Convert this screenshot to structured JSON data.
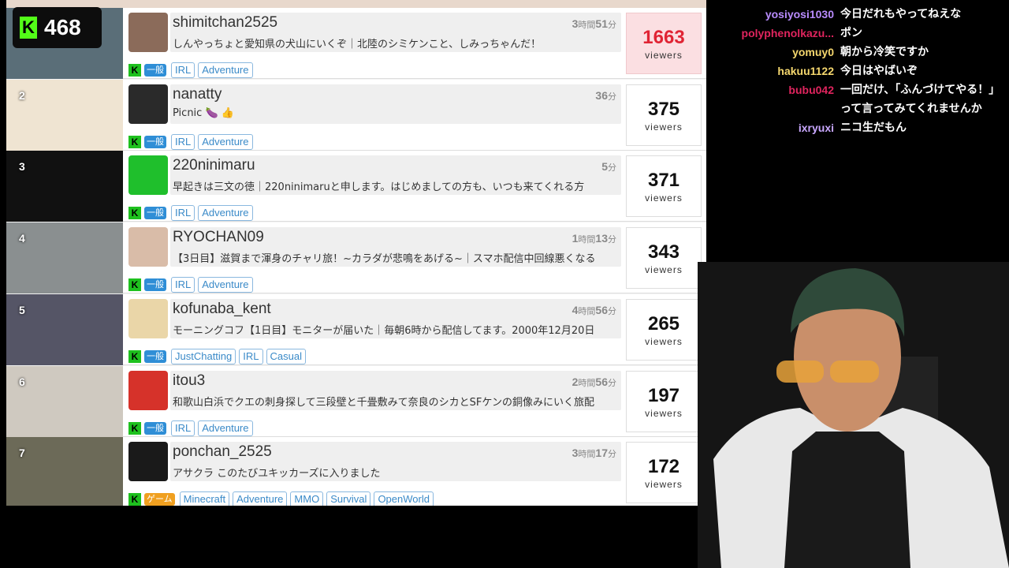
{
  "counter": {
    "value": "468",
    "k": "K"
  },
  "rows": [
    {
      "rank": "",
      "name": "shimitchan2525",
      "time_h": "3",
      "time_m": "51",
      "desc": "しんやっちょと愛知県の犬山にいくぞ｜北陸のシミケンこと、しみっちゃんだ！",
      "cat": "一般",
      "tags": [
        "IRL",
        "Adventure"
      ],
      "viewers": "1663"
    },
    {
      "rank": "2",
      "name": "nanatty",
      "time_h": "",
      "time_m": "36",
      "desc": "Picnic 🍆 👍",
      "cat": "一般",
      "tags": [
        "IRL",
        "Adventure"
      ],
      "viewers": "375"
    },
    {
      "rank": "3",
      "name": "220ninimaru",
      "time_h": "",
      "time_m": "5",
      "desc": "早起きは三文の徳｜220ninimaruと申します。はじめましての方も、いつも来てくれる方",
      "cat": "一般",
      "tags": [
        "IRL",
        "Adventure"
      ],
      "viewers": "371"
    },
    {
      "rank": "4",
      "name": "RYOCHAN09",
      "time_h": "1",
      "time_m": "13",
      "desc": "【3日目】滋賀まで渾身のチャリ旅！~カラダが悲鳴をあげる~｜スマホ配信中回線悪くなる",
      "cat": "一般",
      "tags": [
        "IRL",
        "Adventure"
      ],
      "viewers": "343"
    },
    {
      "rank": "5",
      "name": "kofunaba_kent",
      "time_h": "4",
      "time_m": "56",
      "desc": "モーニングコフ【1日目】モニターが届いた｜毎朝6時から配信してます。2000年12月20日",
      "cat": "一般",
      "tags": [
        "JustChatting",
        "IRL",
        "Casual"
      ],
      "viewers": "265"
    },
    {
      "rank": "6",
      "name": "itou3",
      "time_h": "2",
      "time_m": "56",
      "desc": "和歌山白浜でクエの刺身探して三段壁と千畳敷みて奈良のシカとSFケンの銅像みにいく旅配",
      "cat": "一般",
      "tags": [
        "IRL",
        "Adventure"
      ],
      "viewers": "197"
    },
    {
      "rank": "7",
      "name": "ponchan_2525",
      "time_h": "3",
      "time_m": "17",
      "desc": "アサクラ このたびユキッカーズに入りました",
      "cat": "ゲーム",
      "tags": [
        "Minecraft",
        "Adventure",
        "MMO",
        "Survival",
        "OpenWorld"
      ],
      "viewers": "172"
    }
  ],
  "labels": {
    "viewers": "viewers",
    "hours": "時間",
    "minutes": "分",
    "k": "K"
  },
  "chat": [
    {
      "user": "yosiyosi1030",
      "color": "#b98cff",
      "text": "今日だれもやってねえな"
    },
    {
      "user": "polyphenolkazu...",
      "color": "#e0245e",
      "text": "ポン"
    },
    {
      "user": "yomuy0",
      "color": "#f5d76e",
      "text": "朝から冷笑ですか"
    },
    {
      "user": "hakuu1122",
      "color": "#f5d76e",
      "text": "今日はやばいぞ"
    },
    {
      "user": "bubu042",
      "color": "#e0245e",
      "text": "一回だけ、「ふんづけてやる！」って言ってみてくれませんか"
    },
    {
      "user": "ixryuxi",
      "color": "#c9a8ff",
      "text": "ニコ生だもん"
    }
  ]
}
